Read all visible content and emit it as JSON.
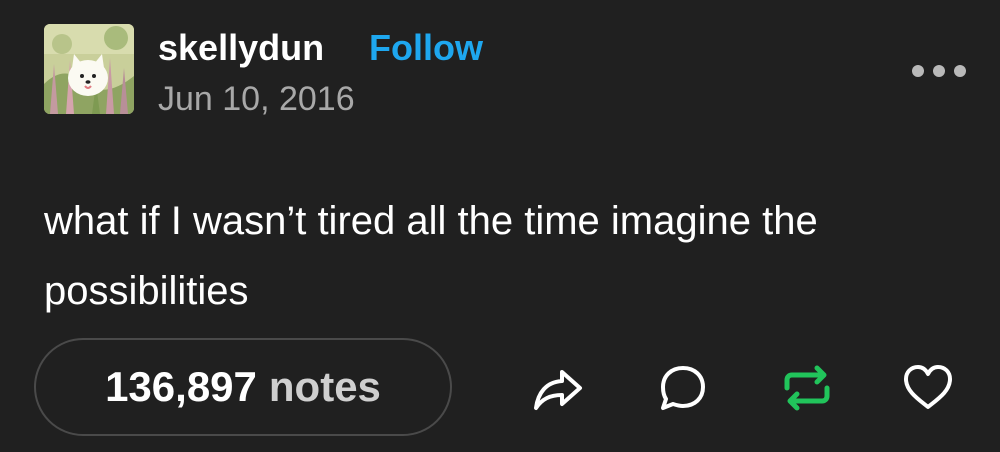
{
  "post": {
    "username": "skellydun",
    "follow_label": "Follow",
    "date": "Jun 10, 2016",
    "body": "what if I wasn’t tired all the time imagine the possibilities"
  },
  "footer": {
    "notes_count": "136,897",
    "notes_label": "notes",
    "actions": {
      "share_icon": "share-icon",
      "reply_icon": "reply-icon",
      "reblog_icon": "reblog-icon",
      "like_icon": "heart-icon",
      "reblog_color": "#21c45b"
    }
  },
  "colors": {
    "background": "#202020",
    "accent": "#1ea7ef",
    "muted": "#a8a8a8"
  }
}
